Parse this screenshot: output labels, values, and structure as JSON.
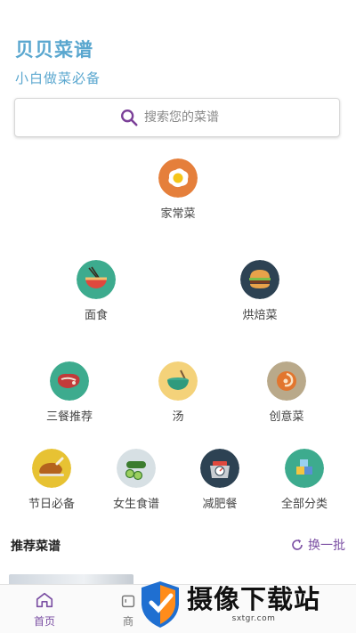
{
  "header": {
    "title": "贝贝菜谱",
    "subtitle": "小白做菜必备"
  },
  "search": {
    "placeholder": "搜索您的菜谱",
    "icon": "search-icon"
  },
  "categories": [
    {
      "label": "家常菜",
      "icon": "fried-egg-icon",
      "color": "#e57f3b"
    },
    {
      "label": "面食",
      "icon": "noodle-bowl-icon",
      "color": "#3dab8e"
    },
    {
      "label": "烘焙菜",
      "icon": "burger-icon",
      "color": "#2d4253"
    },
    {
      "label": "三餐推荐",
      "icon": "steak-icon",
      "color": "#3dab8e"
    },
    {
      "label": "汤",
      "icon": "soup-bowl-icon",
      "color": "#f4d27a"
    },
    {
      "label": "创意菜",
      "icon": "creative-dish-icon",
      "color": "#b9a98a"
    },
    {
      "label": "节日必备",
      "icon": "roast-chicken-icon",
      "color": "#e7c233"
    },
    {
      "label": "女生食谱",
      "icon": "cucumber-icon",
      "color": "#d7e0e4"
    },
    {
      "label": "减肥餐",
      "icon": "scale-icon",
      "color": "#2d4253"
    },
    {
      "label": "全部分类",
      "icon": "blocks-icon",
      "color": "#3dab8e"
    }
  ],
  "recommend": {
    "title": "推荐菜谱",
    "refresh_label": "换一批",
    "refresh_icon": "refresh-icon"
  },
  "bottom_nav": {
    "items": [
      {
        "label": "首页",
        "icon": "home-icon",
        "active": true
      },
      {
        "label": "商",
        "icon": "shop-icon",
        "active": false
      }
    ]
  },
  "colors": {
    "brand": "#5aa7cf",
    "accent": "#7b4fa3"
  },
  "watermark": {
    "text": "摄像下载站",
    "url": "sxtgr.com"
  }
}
